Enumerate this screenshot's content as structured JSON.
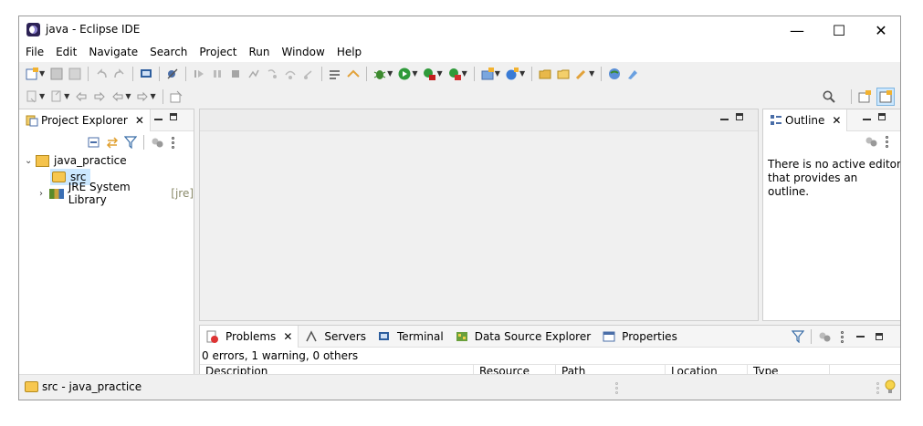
{
  "window": {
    "title": "java - Eclipse IDE",
    "minimize_glyph": "—",
    "maximize_glyph": "☐",
    "close_glyph": "✕"
  },
  "menu": [
    "File",
    "Edit",
    "Navigate",
    "Search",
    "Project",
    "Run",
    "Window",
    "Help"
  ],
  "project_explorer": {
    "tab_label": "Project Explorer",
    "tree": {
      "project": "java_practice",
      "children": [
        {
          "label": "src",
          "selected": true
        },
        {
          "label": "JRE System Library",
          "suffix": "[jre]"
        }
      ]
    }
  },
  "outline": {
    "tab_label": "Outline",
    "message_line1": "There is no active editor",
    "message_line2": "that provides an outline."
  },
  "bottom_panel": {
    "tabs": [
      "Problems",
      "Servers",
      "Terminal",
      "Data Source Explorer",
      "Properties"
    ],
    "active_tab": "Problems",
    "summary": "0 errors, 1 warning, 0 others",
    "columns": [
      "Description",
      "Resource",
      "Path",
      "Location",
      "Type"
    ]
  },
  "status": {
    "text": "src - java_practice"
  },
  "colors": {
    "accent_selected": "#cce8ff",
    "panel_border": "#cfcfcf"
  },
  "icons": [
    "new-icon",
    "save-icon",
    "debug-icon",
    "run-icon",
    "search-icon",
    "lightbulb-icon",
    "filter-icon",
    "view-menu-icon"
  ]
}
